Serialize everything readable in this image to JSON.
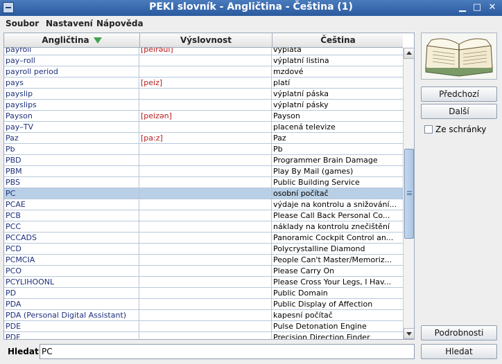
{
  "window": {
    "title": "PEKI slovník - Angličtina - Čeština  (1)",
    "buttons": {
      "minimize": "▁",
      "maximize": "□",
      "close": "✕"
    }
  },
  "menu": [
    "Soubor",
    "Nastavení",
    "Nápověda"
  ],
  "table": {
    "columns": [
      "Angličtina",
      "Výslovnost",
      "Čeština"
    ],
    "sort_column": "Angličtina",
    "selected_row": 13,
    "rows": [
      [
        "payroll",
        "[peirəul]",
        "výplata"
      ],
      [
        "pay–roll",
        "",
        "výplatní listina"
      ],
      [
        "payroll period",
        "",
        "mzdové"
      ],
      [
        "pays",
        "[peiz]",
        "platí"
      ],
      [
        "payslip",
        "",
        "výplatní páska"
      ],
      [
        "payslips",
        "",
        "výplatní pásky"
      ],
      [
        "Payson",
        "[peizən]",
        "Payson"
      ],
      [
        "pay–TV",
        "",
        "placená televize"
      ],
      [
        "Paz",
        "[pa:z]",
        "Paz"
      ],
      [
        "Pb",
        "",
        "Pb"
      ],
      [
        "PBD",
        "",
        "Programmer Brain Damage"
      ],
      [
        "PBM",
        "",
        "Play By Mail (games)"
      ],
      [
        "PBS",
        "",
        "Public Building Service"
      ],
      [
        "PC",
        "",
        "osobní počítač"
      ],
      [
        "PCAE",
        "",
        "výdaje na kontrolu a snižování..."
      ],
      [
        "PCB",
        "",
        "Please Call Back Personal Co..."
      ],
      [
        "PCC",
        "",
        "náklady na kontrolu znečištění"
      ],
      [
        "PCCADS",
        "",
        "Panoramic Cockpit Control an..."
      ],
      [
        "PCD",
        "",
        "Polycrystalline Diamond"
      ],
      [
        "PCMCIA",
        "",
        "People Can't Master/Memoriz..."
      ],
      [
        "PCO",
        "",
        "Please Carry On"
      ],
      [
        "PCYLIHOONL",
        "",
        "Please Cross Your Legs, I Hav..."
      ],
      [
        "PD",
        "",
        "Public Domain"
      ],
      [
        "PDA",
        "",
        "Public Display of Affection"
      ],
      [
        "PDA (Personal Digital Assistant)",
        "",
        "kapesní počítač"
      ],
      [
        "PDE",
        "",
        "Pulse Detonation Engine"
      ],
      [
        "PDF",
        "",
        "Precision Direction Finder"
      ]
    ]
  },
  "buttons": {
    "previous": "Předchozí",
    "next": "Další",
    "clipboard": "Ze schránky",
    "details": "Podrobnosti",
    "search": "Hledat"
  },
  "search": {
    "label": "Hledat:",
    "value": "PC"
  },
  "icons": {
    "app": "dictionary-app-icon",
    "book": "open-book-icon",
    "sort": "sort-descending-icon"
  },
  "colors": {
    "titlebar": "#3566a8",
    "selection": "#b8cfe5",
    "english_text": "#1c2f7c",
    "pronunciation_text": "#b41a1a",
    "sort_arrow": "#3fa34d"
  }
}
